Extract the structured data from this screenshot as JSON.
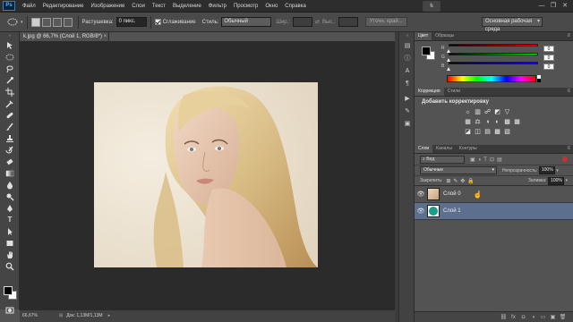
{
  "app": {
    "logo": "Ps"
  },
  "menu": [
    "Файл",
    "Редактирование",
    "Изображение",
    "Слои",
    "Текст",
    "Выделение",
    "Фильтр",
    "Просмотр",
    "Окно",
    "Справка"
  ],
  "window_controls": {
    "minimize": "—",
    "restore": "❐",
    "close": "✕"
  },
  "options_bar": {
    "feather_label": "Растушевка:",
    "feather_value": "0 пикс.",
    "antialias_label": "Сглаживание",
    "style_label": "Стиль:",
    "style_value": "Обычный",
    "width_label": "Шир.:",
    "height_label": "Выс.:",
    "refine_button": "Уточн. край...",
    "swap_icon": "⇄",
    "workspace_value": "Основная рабочая среда"
  },
  "document": {
    "tab_label": "k.jpg @ 66,7% (Слой 1, RGB/8*)",
    "tab_close": "×",
    "zoom": "66,67%",
    "doc_size": "Док: 1,13М/1,13М"
  },
  "panels": {
    "color": {
      "tabs": [
        "Цвет",
        "Образцы"
      ],
      "channels": [
        {
          "label": "R",
          "value": "0",
          "gradient": "linear-gradient(to right,#000,#f00)"
        },
        {
          "label": "G",
          "value": "0",
          "gradient": "linear-gradient(to right,#000,#0f0)"
        },
        {
          "label": "B",
          "value": "0",
          "gradient": "linear-gradient(to right,#000,#00f)"
        }
      ],
      "fg_color": "#000000",
      "bg_color": "#ffffff"
    },
    "adjustments": {
      "tabs": [
        "Коррекция",
        "Стили"
      ],
      "heading": "Добавить корректировку",
      "row1": [
        "☼",
        "▥",
        "☍",
        "◩",
        "▽"
      ],
      "row2": [
        "▦",
        "⚖",
        "◑",
        "◐",
        "▩",
        "▦"
      ],
      "row3": [
        "◪",
        "◫",
        "▤",
        "▩",
        "▧"
      ]
    },
    "layers": {
      "tabs": [
        "Слои",
        "Каналы",
        "Контуры"
      ],
      "filter_label": "Вид",
      "blend_mode": "Обычные",
      "opacity_label": "Непрозрачность:",
      "opacity_value": "100%",
      "lock_label": "Закрепить:",
      "fill_label": "Заливка:",
      "fill_value": "100%",
      "items": [
        {
          "name": "Слой 0",
          "selected": false,
          "thumb": "photo"
        },
        {
          "name": "Слой 1",
          "selected": true,
          "thumb": "teal"
        }
      ],
      "teal_color": "#1b9e86",
      "footer_icons": [
        "⛓",
        "fx",
        "◘",
        "◑",
        "▭",
        "▣",
        "🗑"
      ]
    }
  }
}
